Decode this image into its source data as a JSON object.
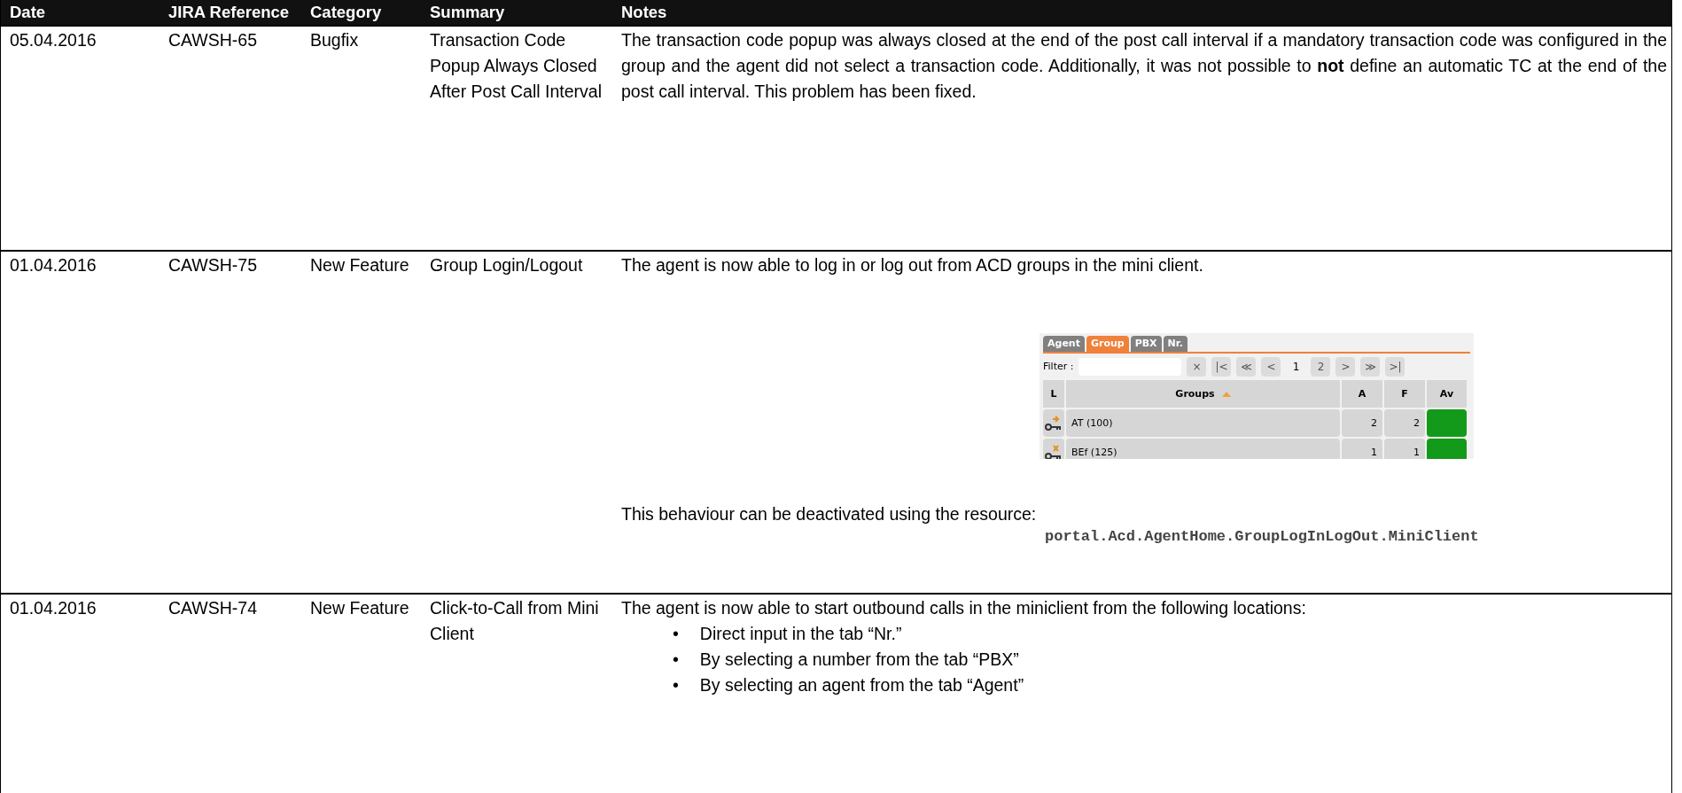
{
  "table": {
    "columns": [
      "Date",
      "JIRA Reference",
      "Category",
      "Summary",
      "Notes"
    ],
    "rows": [
      {
        "date": "05.04.2016",
        "jira": "CAWSH-65",
        "category": "Bugfix",
        "summary": "Transaction Code Popup Always Closed After Post Call Interval",
        "notes": [
          {
            "kind": "paragraph",
            "text": "The transaction code popup was always closed at the end of the post call interval if a mandatory transaction code was configured in the group and the agent did not select a transaction code. Additionally, it was not possible to **not** define an automatic TC at the end of the post call interval. This problem has been fixed."
          }
        ]
      },
      {
        "date": "01.04.2016",
        "jira": "CAWSH-75",
        "category": "New Feature",
        "summary": "Group Login/Logout",
        "notes": [
          {
            "kind": "paragraph",
            "text": "The agent is now able to log in or log out from ACD groups in the mini client."
          },
          {
            "kind": "screenshot",
            "tabs": [
              {
                "label": "Agent",
                "selected": false
              },
              {
                "label": "Group",
                "selected": true
              },
              {
                "label": "PBX",
                "selected": false
              },
              {
                "label": "Nr.",
                "selected": false
              }
            ],
            "filter_label": "Filter :",
            "pager_start": [
              "×",
              "|<",
              "≪",
              "<"
            ],
            "pages": [
              {
                "label": "1",
                "selected": true
              },
              {
                "label": "2",
                "selected": false
              }
            ],
            "pager_end": [
              ">",
              "≫",
              ">|"
            ],
            "columns": [
              "L",
              "Groups",
              "A",
              "F",
              "Av"
            ],
            "rows": [
              {
                "logged_in": true,
                "group": "AT (100)",
                "a": "2",
                "f": "2"
              },
              {
                "logged_in": false,
                "group": "BEf (125)",
                "a": "1",
                "f": "1"
              }
            ]
          },
          {
            "kind": "paragraph",
            "text": "This behaviour can be deactivated using the resource:"
          },
          {
            "kind": "code",
            "text": "portal.Acd.AgentHome.GroupLogInLogOut.MiniClient"
          }
        ]
      },
      {
        "date": "01.04.2016",
        "jira": "CAWSH-74",
        "category": "New Feature",
        "summary": "Click-to-Call from Mini Client",
        "notes": [
          {
            "kind": "paragraph",
            "text": "The agent is now able to start outbound calls in the miniclient from the following locations:"
          },
          {
            "kind": "bullets",
            "marker": "•",
            "items": [
              "Direct input in the tab “Nr.”",
              "By selecting a number from the tab “PBX”",
              "By selecting an agent from the tab “Agent”"
            ]
          }
        ]
      }
    ]
  }
}
